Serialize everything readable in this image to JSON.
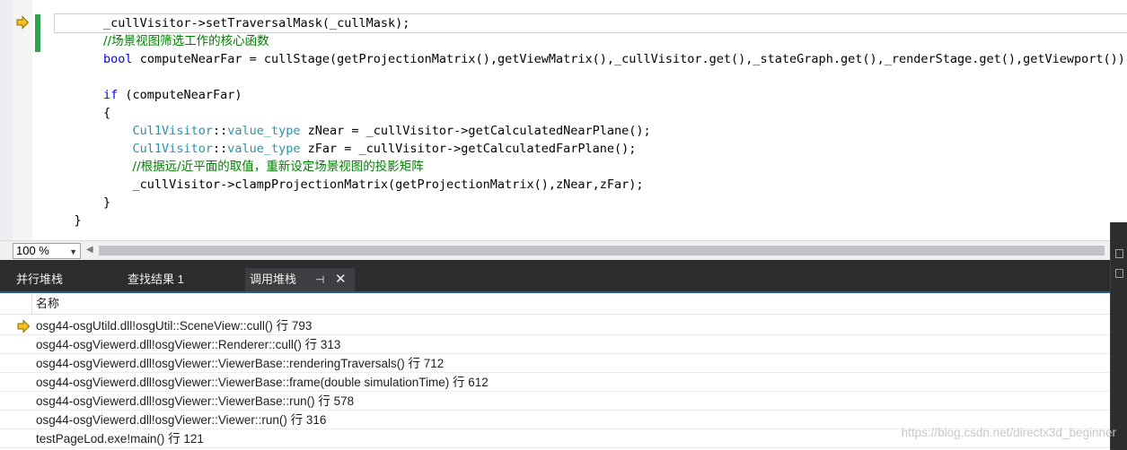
{
  "editor": {
    "code_lines": [
      "_cullVisitor->setTraversalMask(_cullMask);",
      "//场景视图筛选工作的核心函数",
      "computeNearFar = cullStage(getProjectionMatrix(),getViewMatrix(),_cullVisitor.get(),_stateGraph.get(),_renderStage.get(),getViewport());",
      "",
      "if (computeNearFar)",
      "{",
      "Cul1Visitor::value_type zNear = _cullVisitor->getCalculatedNearPlane();",
      "Cul1Visitor::value_type zFar = _cullVisitor->getCalculatedFarPlane();",
      "//根据远/近平面的取值，重新设定场景视图的投影矩阵",
      "_cullVisitor->clampProjectionMatrix(getProjectionMatrix(),zNear,zFar);",
      "}",
      "}"
    ],
    "tokens": {
      "bool": "bool",
      "if": "if",
      "class_name": "Cul1Visitor",
      "scope": "::",
      "value_type": "value_type"
    },
    "colors": {
      "keyword": "#0000ff",
      "type": "#2b91af",
      "comment": "#008000",
      "change_bar": "#2ea44f",
      "exec_arrow": "#f4c01e"
    }
  },
  "zoom": {
    "level": "100 %"
  },
  "tabs": [
    {
      "label": "并行堆栈",
      "active": false
    },
    {
      "label": "查找结果 1",
      "active": false
    },
    {
      "label": "调用堆栈",
      "active": true
    }
  ],
  "callstack": {
    "header": "名称",
    "current_row": 0,
    "rows": [
      "osg44-osgUtild.dll!osgUtil::SceneView::cull() 行 793",
      "osg44-osgViewerd.dll!osgViewer::Renderer::cull() 行 313",
      "osg44-osgViewerd.dll!osgViewer::ViewerBase::renderingTraversals() 行 712",
      "osg44-osgViewerd.dll!osgViewer::ViewerBase::frame(double simulationTime) 行 612",
      "osg44-osgViewerd.dll!osgViewer::ViewerBase::run() 行 578",
      "osg44-osgViewerd.dll!osgViewer::Viewer::run() 行 316",
      "testPageLod.exe!main() 行 121"
    ]
  },
  "watermark": "https://blog.csdn.net/directx3d_beginner"
}
